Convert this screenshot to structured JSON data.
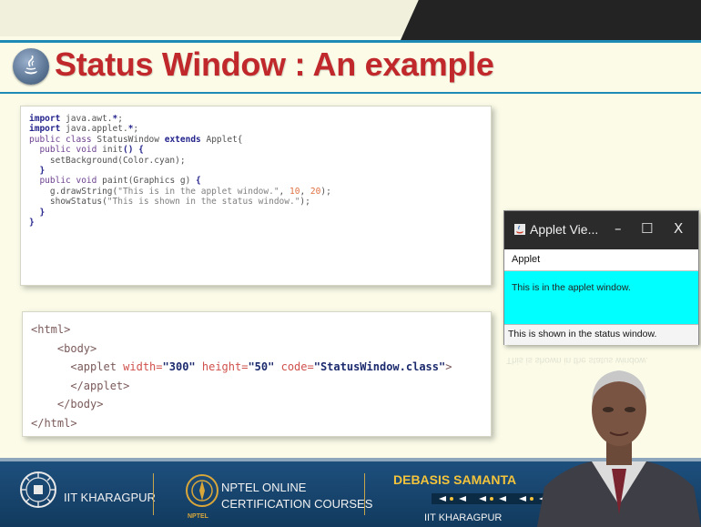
{
  "slide": {
    "title": "Status Window : An example"
  },
  "java_code": [
    [
      {
        "t": "import",
        "c": "kw"
      },
      {
        "t": " java.awt."
      },
      {
        "t": "*",
        "c": "kw"
      },
      {
        "t": ";"
      }
    ],
    [
      {
        "t": "import",
        "c": "kw"
      },
      {
        "t": " java.applet."
      },
      {
        "t": "*",
        "c": "kw"
      },
      {
        "t": ";"
      }
    ],
    [
      {
        "t": "public class",
        "c": "kw2"
      },
      {
        "t": " StatusWindow "
      },
      {
        "t": "extends",
        "c": "kw"
      },
      {
        "t": " Applet{"
      }
    ],
    [
      {
        "t": "  "
      },
      {
        "t": "public void",
        "c": "kw2"
      },
      {
        "t": " init"
      },
      {
        "t": "()",
        "c": "kw"
      },
      {
        "t": " "
      },
      {
        "t": "{",
        "c": "kw"
      }
    ],
    [
      {
        "t": "    setBackground(Color.cyan);"
      }
    ],
    [
      {
        "t": "  "
      },
      {
        "t": "}",
        "c": "kw"
      }
    ],
    [
      {
        "t": "  "
      },
      {
        "t": "public void",
        "c": "kw2"
      },
      {
        "t": " paint(Graphics g) "
      },
      {
        "t": "{",
        "c": "kw"
      }
    ],
    [
      {
        "t": "    g.drawString("
      },
      {
        "t": "\"This is in the applet window.\"",
        "c": "str"
      },
      {
        "t": ", "
      },
      {
        "t": "10",
        "c": "num"
      },
      {
        "t": ", "
      },
      {
        "t": "20",
        "c": "num"
      },
      {
        "t": ");"
      }
    ],
    [
      {
        "t": "    showStatus("
      },
      {
        "t": "\"This is shown in the status window.\"",
        "c": "str"
      },
      {
        "t": ");"
      }
    ],
    [
      {
        "t": "  "
      },
      {
        "t": "}",
        "c": "kw"
      }
    ],
    [
      {
        "t": "}",
        "c": "kw"
      }
    ]
  ],
  "html_code": [
    [
      {
        "t": "<html>",
        "c": "tag"
      }
    ],
    [
      {
        "t": "    "
      },
      {
        "t": "<body>",
        "c": "tag"
      }
    ],
    [
      {
        "t": "      "
      },
      {
        "t": "<applet ",
        "c": "tag"
      },
      {
        "t": "width=",
        "c": "attr"
      },
      {
        "t": "\"300\"",
        "c": "aval"
      },
      {
        "t": " "
      },
      {
        "t": "height=",
        "c": "attr"
      },
      {
        "t": "\"50\"",
        "c": "aval"
      },
      {
        "t": " "
      },
      {
        "t": "code=",
        "c": "attr"
      },
      {
        "t": "\"StatusWindow.class\"",
        "c": "aval"
      },
      {
        "t": ">",
        "c": "tag"
      }
    ],
    [
      {
        "t": "      "
      },
      {
        "t": "</applet>",
        "c": "tag"
      }
    ],
    [
      {
        "t": "    "
      },
      {
        "t": "</body>",
        "c": "tag"
      }
    ],
    [
      {
        "t": "</html>",
        "c": "tag"
      }
    ]
  ],
  "applet_viewer": {
    "window_title": "Applet Vie...",
    "minimize_label": "–",
    "maximize_label": "☐",
    "close_label": "X",
    "menu_label": "Applet",
    "canvas_text": "This is in the applet window.",
    "status_text": "This is shown in the status window.",
    "canvas_color": "#00ffff"
  },
  "footer": {
    "institute_logo_text": "IIT KHARAGPUR",
    "nptel_line1": "NPTEL ONLINE",
    "nptel_line2": "CERTIFICATION COURSES",
    "nptel_small": "NPTEL",
    "presenter_name": "DEBASIS SAMANTA",
    "presenter_institute": "IIT KHARAGPUR"
  },
  "colors": {
    "title": "#c0282c",
    "accent_line": "#1e8bb6",
    "footer_bg": "#1d4f7d",
    "presenter_name": "#f3c33c"
  }
}
